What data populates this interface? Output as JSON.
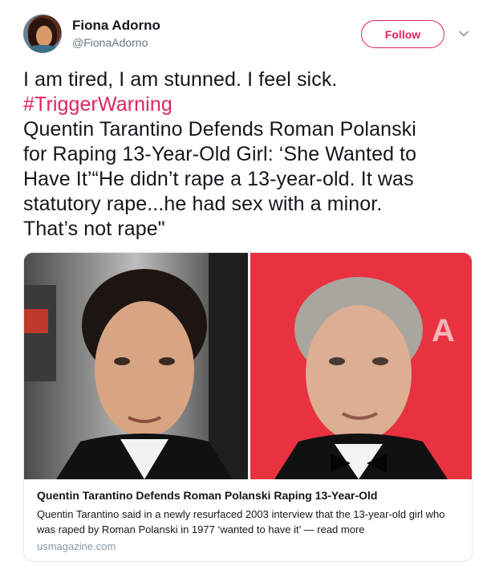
{
  "user": {
    "display_name": "Fiona Adorno",
    "handle": "@FionaAdorno"
  },
  "follow_label": "Follow",
  "tweet": {
    "lines": [
      "I am tired, I am stunned. I feel sick.",
      "#TriggerWarning",
      "Quentin Tarantino Defends Roman Polanski",
      "for Raping 13-Year-Old Girl: ‘She Wanted to",
      "Have It’“He didn’t rape a 13-year-old. It was",
      "statutory rape...he had sex with a minor.",
      "That’s not rape\""
    ]
  },
  "card": {
    "title": "Quentin Tarantino Defends Roman Polanski Raping 13-Year-Old",
    "description": "Quentin Tarantino said in a newly resurfaced 2003 interview that the 13-year-old girl who was raped by Roman Polanski in 1977 ‘wanted to have it’ — read more",
    "domain": "usmagazine.com"
  },
  "colors": {
    "accent": "#e0245e",
    "text": "#14171a",
    "secondary": "#657786"
  }
}
